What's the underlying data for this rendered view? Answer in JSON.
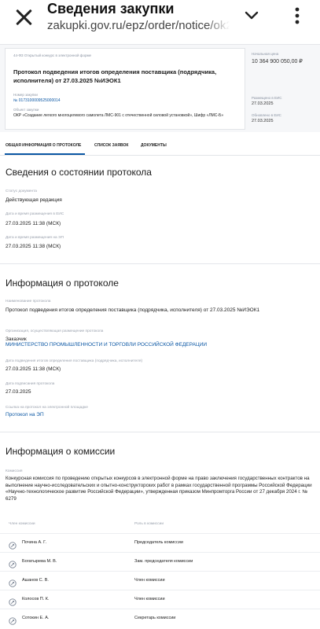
{
  "browser": {
    "title": "Сведения закупки",
    "url": "zakupki.gov.ru/epz/order/notice/ok20"
  },
  "summary": {
    "breadcrumb": "44-ФЗ Открытый конкурс в электронной форме",
    "protocol_title": "Протокол подведения итогов определения поставщика (подрядчика, исполнителя) от 27.03.2025 №ИЭОК1",
    "purchase_number_label": "Номер закупки",
    "purchase_number": "№ 0173100009525000014",
    "object_label": "Объект закупки",
    "object_value": "ОКР «Создание легкого многоцелевого самолета ЛМС-901 с отечественной силовой установкой», Шифр «ЛМС-Б»",
    "price_label": "Начальная цена",
    "price_value": "10 364 900 050,00 ₽",
    "placed_label": "Размещено в ЕИС",
    "placed_value": "27.03.2025",
    "updated_label": "Обновлено в ЕИС",
    "updated_value": "27.03.2025"
  },
  "tabs": [
    {
      "label": "ОБЩАЯ ИНФОРМАЦИЯ О ПРОТОКОЛЕ",
      "active": true
    },
    {
      "label": "СПИСОК ЗАЯВОК",
      "active": false
    },
    {
      "label": "ДОКУМЕНТЫ",
      "active": false
    }
  ],
  "status_section": {
    "title": "Сведения о состоянии протокола",
    "fields": [
      {
        "label": "Статус документа",
        "value": "Действующая редакция"
      },
      {
        "label": "Дата и время размещения в ЕИС",
        "value": "27.03.2025 11:38 (МСК)"
      },
      {
        "label": "Дата и время размещения на ЭП",
        "value": "27.03.2025 11:38 (МСК)"
      }
    ]
  },
  "protocol_section": {
    "title": "Информация о протоколе",
    "name_label": "Наименование протокола",
    "name_value": "Протокол подведения итогов определения поставщика (подрядчика, исполнителя) от 27.03.2025 №ИЭОК1",
    "org_label": "Организация, осуществляющая размещение протокола",
    "org_role": "Заказчик",
    "org_name": "МИНИСТЕРСТВО ПРОМЫШЛЕННОСТИ И ТОРГОВЛИ РОССИЙСКОЙ ФЕДЕРАЦИИ",
    "results_date_label": "Дата подведения итогов определения поставщика (подрядчика, исполнителя)",
    "results_date_value": "27.03.2025 11:38 (МСК)",
    "signed_label": "Дата подписания протокола",
    "signed_value": "27.03.2025",
    "platform_label": "Ссылка на протокол на электронной площадке",
    "platform_link": "Протокол на ЭП"
  },
  "commission_section": {
    "title": "Информация о комиссии",
    "commission_label": "Комиссия",
    "commission_value": "Конкурсная комиссия по проведению открытых конкурсов в электронной форме на право заключения государственных контрактов на выполнение научно-исследовательских и опытно-конструкторских работ в рамках государственной программы Российской Федерации «Научно-технологическое развитие Российской Федерации», утвержденная приказом Минпромторга России от 27 декабря 2024 г. № 6279",
    "col_member": "Член комиссии",
    "col_role": "Роль в комиссии",
    "members": [
      {
        "name": "Почина А. Г.",
        "role": "Председатель комиссии"
      },
      {
        "name": "Богатырева М. В.",
        "role": "Зам. председателя комиссии"
      },
      {
        "name": "Ашанов С. В.",
        "role": "Член комиссии"
      },
      {
        "name": "Колосов П. К.",
        "role": "Член комиссии"
      },
      {
        "name": "Сотокин Е. А.",
        "role": "Секретарь комиссии"
      }
    ]
  },
  "colors": {
    "link": "#0b57a4",
    "label": "#9aa1ad",
    "text": "#1a1a1a"
  }
}
